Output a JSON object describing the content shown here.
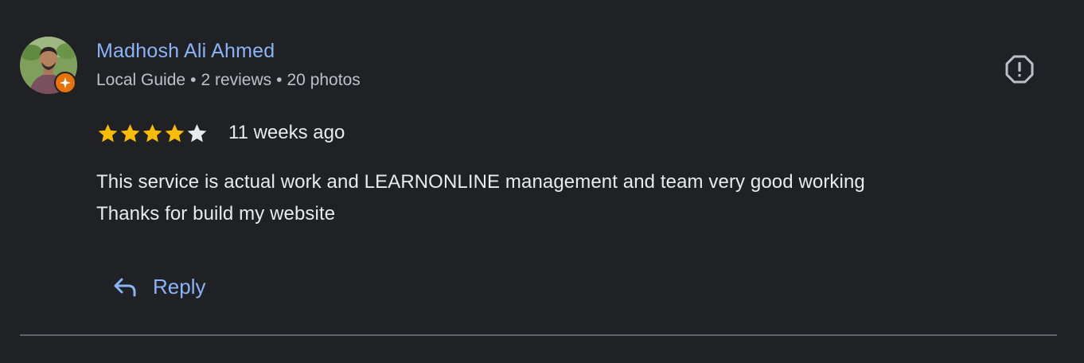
{
  "reviewer": {
    "name": "Madhosh Ali Ahmed",
    "badge": "Local Guide",
    "reviews": "2 reviews",
    "photos": "20 photos",
    "separator": "•",
    "avatar_icon": "profile-photo",
    "badge_icon": "local-guide-star-icon"
  },
  "rating": {
    "value": 4,
    "max": 5,
    "filled_color": "#fbbc04",
    "empty_color": "#e8eaed"
  },
  "time_ago": "11 weeks ago",
  "review_text": {
    "line1": "This service is actual work and LEARNONLINE management and team very good working",
    "line2": "Thanks for build my website"
  },
  "actions": {
    "reply_label": "Reply",
    "reply_icon": "reply-arrow-icon",
    "report_icon": "report-flag-icon"
  },
  "colors": {
    "background": "#202124",
    "link": "#8ab4f8",
    "text": "#e8eaed",
    "secondary_text": "#bdc1c6",
    "badge": "#e8710a",
    "divider": "#5f6368"
  }
}
